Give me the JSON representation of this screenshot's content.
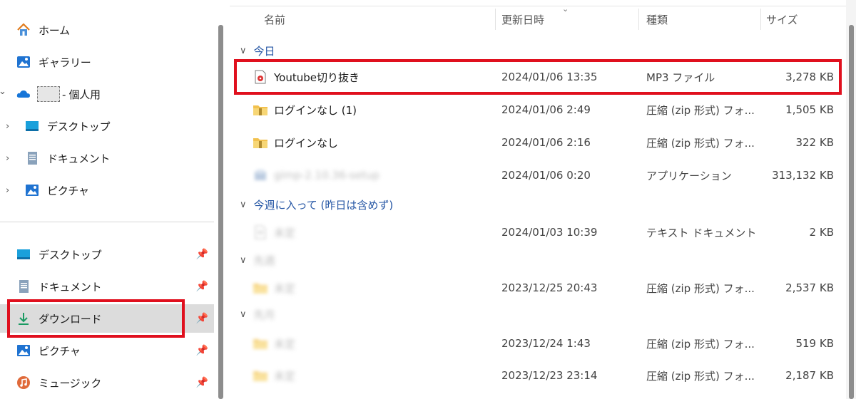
{
  "sidebar": {
    "tree": [
      {
        "label": "ホーム",
        "icon": "home-icon",
        "chevron": ""
      },
      {
        "label": "ギャラリー",
        "icon": "gallery-icon",
        "chevron": ""
      },
      {
        "label": "- 個人用",
        "icon": "onedrive-cloud-icon",
        "chevron": "⌄"
      },
      {
        "label": "デスクトップ",
        "icon": "desktop-icon",
        "chevron": "›"
      },
      {
        "label": "ドキュメント",
        "icon": "documents-icon",
        "chevron": "›"
      },
      {
        "label": "ピクチャ",
        "icon": "pictures-icon",
        "chevron": "›"
      }
    ],
    "quick_access": [
      {
        "label": "デスクトップ",
        "icon": "desktop-icon"
      },
      {
        "label": "ドキュメント",
        "icon": "documents-icon"
      },
      {
        "label": "ダウンロード",
        "icon": "download-icon",
        "selected": true
      },
      {
        "label": "ピクチャ",
        "icon": "pictures-icon"
      },
      {
        "label": "ミュージック",
        "icon": "music-icon"
      }
    ],
    "pin_glyph": "📌"
  },
  "columns": {
    "name": "名前",
    "date": "更新日時",
    "type": "種類",
    "size": "サイズ",
    "sort_caret": "⌄"
  },
  "groups": [
    {
      "label": "今日",
      "chevron": "∨"
    },
    {
      "label": "今週に入って (昨日は含めず)",
      "chevron": "∨"
    },
    {
      "label": "先週",
      "chevron": "∨"
    },
    {
      "label": "先月",
      "chevron": "∨"
    }
  ],
  "files": [
    {
      "name": "Youtube切り抜き",
      "date": "2024/01/06 13:35",
      "type": "MP3 ファイル",
      "size": "3,278 KB",
      "icon": "mp3-file-icon",
      "highlighted": true
    },
    {
      "name": "ログインなし (1)",
      "date": "2024/01/06 2:49",
      "type": "圧縮 (zip 形式) フォ...",
      "size": "1,505 KB",
      "icon": "zip-folder-icon"
    },
    {
      "name": "ログインなし",
      "date": "2024/01/06 2:16",
      "type": "圧縮 (zip 形式) フォ...",
      "size": "322 KB",
      "icon": "zip-folder-icon"
    },
    {
      "name": "gimp-2.10.36-setup",
      "date": "2024/01/06 0:20",
      "type": "アプリケーション",
      "size": "313,132 KB",
      "icon": "installer-icon",
      "blurred": true
    },
    {
      "name": "未定",
      "date": "2024/01/03 10:39",
      "type": "テキスト ドキュメント",
      "size": "2 KB",
      "icon": "text-file-icon",
      "blurred": true
    },
    {
      "name": "未定",
      "date": "2023/12/25 20:43",
      "type": "圧縮 (zip 形式) フォ...",
      "size": "2,537 KB",
      "icon": "zip-folder-icon",
      "blurred": true
    },
    {
      "name": "未定",
      "date": "2023/12/24 1:43",
      "type": "圧縮 (zip 形式) フォ...",
      "size": "519 KB",
      "icon": "zip-folder-icon",
      "blurred": true
    },
    {
      "name": "未定",
      "date": "2023/12/23 23:14",
      "type": "圧縮 (zip 形式) フォ...",
      "size": "2,187 KB",
      "icon": "zip-folder-icon",
      "blurred": true
    }
  ],
  "colors": {
    "highlight": "#e0101e",
    "group_text": "#2455a4",
    "selected_bg": "#dcdcdc"
  }
}
